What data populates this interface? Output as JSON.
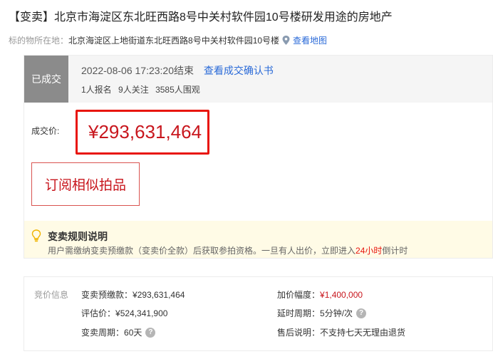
{
  "title": "【变卖】北京市海淀区东北旺西路8号中关村软件园10号楼研发用途的房地产",
  "location": {
    "label": "标的物所在地：",
    "address": "北京海淀区上地街道东北旺西路8号中关村软件园10号楼",
    "map_link": "查看地图",
    "icon": "map-pin-icon"
  },
  "status": {
    "tag": "已成交",
    "end_time": "2022-08-06 17:23:20结束",
    "confirm_link": "查看成交确认书",
    "signups": "1人报名",
    "followers": "9人关注",
    "viewers": "3585人围观"
  },
  "price": {
    "label": "成交价:",
    "value": "¥293,631,464"
  },
  "subscribe": {
    "label": "订阅相似拍品"
  },
  "rules": {
    "icon": "lightbulb-icon",
    "title": "变卖规则说明",
    "text_before": "用户需缴纳变卖预缴款（变卖价全款）后获取参拍资格。一旦有人出价，立即进入",
    "text_highlight": "24小时",
    "text_after": "倒计时"
  },
  "info": {
    "category": "竞价信息",
    "deposit_label": "变卖预缴款：",
    "deposit_value": "¥293,631,464",
    "increment_label": "加价幅度：",
    "increment_value": "¥1,400,000",
    "appraisal_label": "评估价：",
    "appraisal_value": "¥524,341,900",
    "extension_label": "延时周期：",
    "extension_value": "5分钟/次",
    "period_label": "变卖周期：",
    "period_value": "60天",
    "aftersale_label": "售后说明：",
    "aftersale_value": "不支持七天无理由退货",
    "help_icon": "?"
  },
  "colors": {
    "accent_red": "#c8161d",
    "link_blue": "#2a6ad8",
    "status_gray": "#8b8b8b",
    "rules_bg": "#fffbe6"
  }
}
